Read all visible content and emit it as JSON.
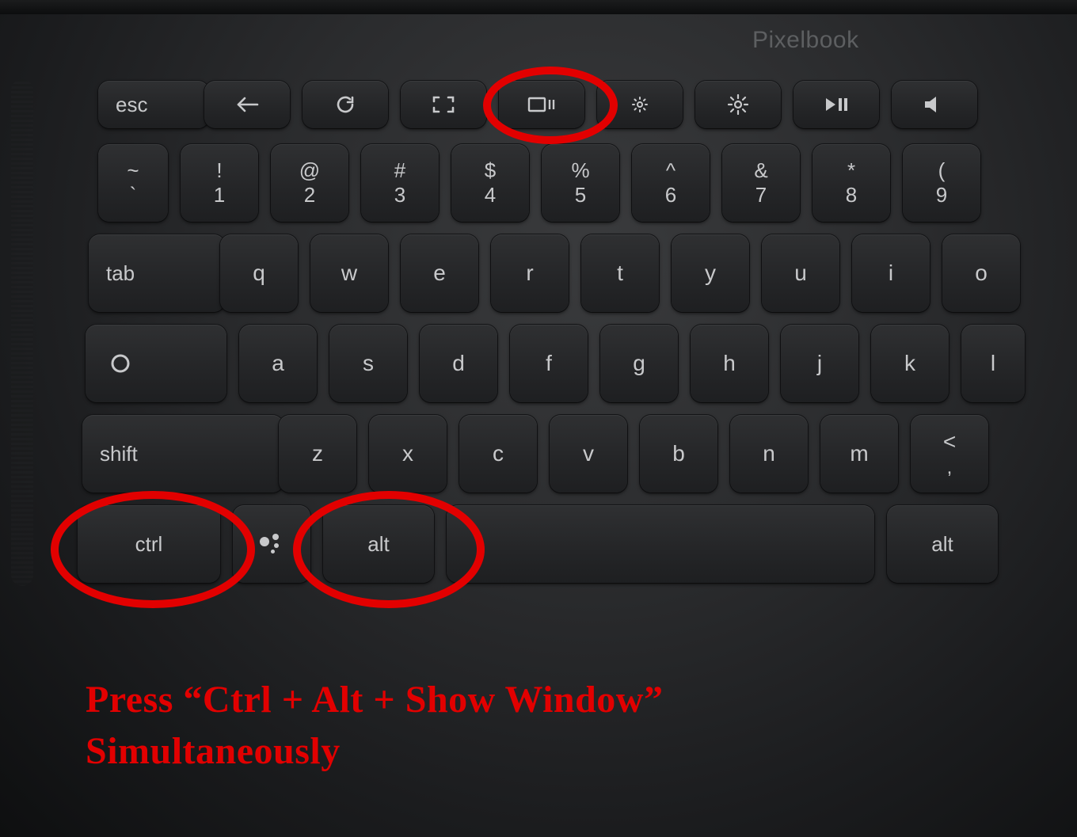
{
  "brand": "Pixelbook",
  "annotation": {
    "line1": "Press “Ctrl + Alt + Show Window”",
    "line2": "Simultaneously"
  },
  "function_row": {
    "esc": "esc"
  },
  "number_row": [
    {
      "top": "~",
      "bot": "`"
    },
    {
      "top": "!",
      "bot": "1"
    },
    {
      "top": "@",
      "bot": "2"
    },
    {
      "top": "#",
      "bot": "3"
    },
    {
      "top": "$",
      "bot": "4"
    },
    {
      "top": "%",
      "bot": "5"
    },
    {
      "top": "^",
      "bot": "6"
    },
    {
      "top": "&",
      "bot": "7"
    },
    {
      "top": "*",
      "bot": "8"
    },
    {
      "top": "(",
      "bot": "9"
    }
  ],
  "row_q": {
    "tab": "tab",
    "keys": [
      "q",
      "w",
      "e",
      "r",
      "t",
      "y",
      "u",
      "i",
      "o"
    ]
  },
  "row_a": {
    "keys": [
      "a",
      "s",
      "d",
      "f",
      "g",
      "h",
      "j",
      "k",
      "l"
    ]
  },
  "row_z": {
    "shift": "shift",
    "keys": [
      "z",
      "x",
      "c",
      "v",
      "b",
      "n",
      "m"
    ],
    "punct": {
      "top": "<",
      "bot": ","
    }
  },
  "row_ctrl": {
    "ctrl": "ctrl",
    "alt": "alt",
    "alt_right": "alt"
  }
}
